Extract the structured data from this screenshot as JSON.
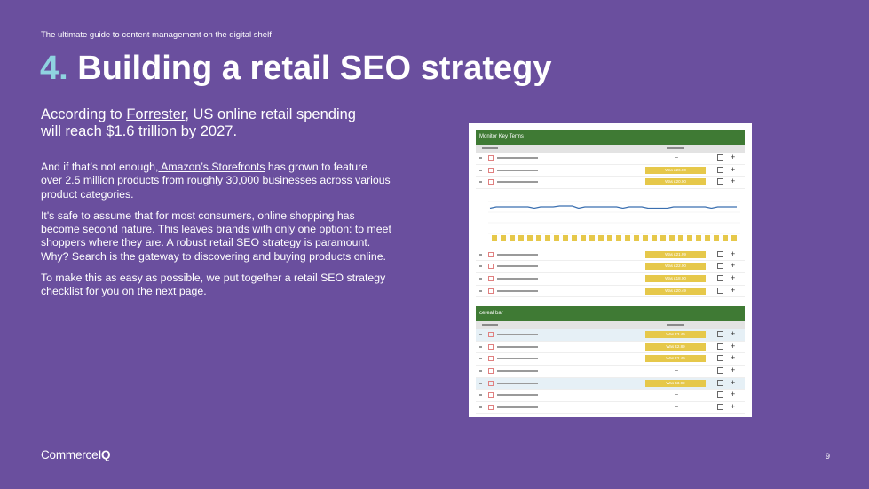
{
  "header": {
    "text": "The ultimate guide to content management on the digital shelf"
  },
  "title": {
    "number": "4.",
    "text": " Building a retail SEO strategy"
  },
  "lead": {
    "before": "According to ",
    "link": "Forrester",
    "after": ", US online retail spending will reach $1.6 trillion by 2027."
  },
  "body": {
    "p1_before": "And if that’s not enough,",
    "p1_link": " Amazon’s Storefronts",
    "p1_after": " has grown to feature over 2.5 million products from roughly 30,000 businesses across various product categories.",
    "p2": "It's safe to assume that for most consumers, online shopping has become second nature. This leaves brands with only one option: to meet shoppers where they are. A robust retail SEO strategy is paramount. Why? Search is the gateway to discovering and buying products online.",
    "p3": "To make this as easy as possible, we put together a retail SEO strategy checklist for you on the next page."
  },
  "footer": {
    "logo_regular": "Commerce",
    "logo_bold": "IQ",
    "page": "9"
  },
  "screenshot": {
    "panel1_title": "Monitor Key Terms",
    "panel2_title": "cereal bar",
    "panel1_rows_top": [
      {
        "tag": "",
        "dash": "–"
      },
      {
        "tag": "Was £26.00",
        "dash": ""
      },
      {
        "tag": "Was £20.00",
        "dash": ""
      }
    ],
    "panel1_rows_bottom": [
      {
        "tag": "Was £21.99",
        "dash": ""
      },
      {
        "tag": "Was £22.00",
        "dash": ""
      },
      {
        "tag": "Was £18.00",
        "dash": ""
      },
      {
        "tag": "Was £20.49",
        "dash": ""
      }
    ],
    "panel2_rows": [
      {
        "tag": "Was £3.49",
        "dash": "",
        "hl": true
      },
      {
        "tag": "Was £2.89",
        "dash": "",
        "hl": false
      },
      {
        "tag": "Was £2.49",
        "dash": "",
        "hl": false
      },
      {
        "tag": "",
        "dash": "–",
        "hl": false
      },
      {
        "tag": "Was £3.99",
        "dash": "",
        "hl": true
      },
      {
        "tag": "",
        "dash": "–",
        "hl": false
      },
      {
        "tag": "",
        "dash": "–",
        "hl": false
      }
    ],
    "colors": {
      "bar": "#3f7a34",
      "tag": "#e6c84a",
      "line": "#3a6fb0",
      "page": "#6a4f9e",
      "accent": "#8fd3e0"
    }
  }
}
